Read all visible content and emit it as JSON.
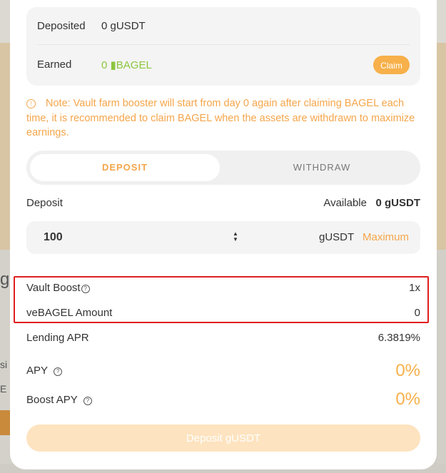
{
  "background": {
    "fragment_1": "g",
    "fragment_2": "si",
    "fragment_3": "E"
  },
  "info": {
    "deposited_label": "Deposited",
    "deposited_value": "0 gUSDT",
    "earned_label": "Earned",
    "earned_value": "0 ▮BAGEL",
    "claim_label": "Claim"
  },
  "note": {
    "icon": "warning-circle-icon",
    "text": "Note: Vault farm booster will start from day 0 again after claiming BAGEL each time, it is recommended to claim BAGEL when the assets are withdrawn to maximize earnings."
  },
  "tabs": [
    {
      "label": "DEPOSIT",
      "active": true
    },
    {
      "label": "WITHDRAW",
      "active": false
    }
  ],
  "deposit": {
    "label": "Deposit",
    "available_label": "Available",
    "available_value": "0 gUSDT",
    "amount": "100",
    "unit": "gUSDT",
    "max_label": "Maximum"
  },
  "stats": {
    "vault_boost_label": "Vault Boost",
    "vault_boost_value": "1x",
    "vebagel_label": "veBAGEL Amount",
    "vebagel_value": "0",
    "lending_apr_label": "Lending APR",
    "lending_apr_value": "6.3819%",
    "apy_label": "APY",
    "apy_value": "0%",
    "boost_apy_label": "Boost APY",
    "boost_apy_value": "0%"
  },
  "action": {
    "deposit_button_label": "Deposit gUSDT"
  },
  "colors": {
    "accent": "#f7b04a",
    "accent_text": "#f5a54a",
    "earned": "#8cc63f",
    "highlight": "#e01e1e"
  }
}
